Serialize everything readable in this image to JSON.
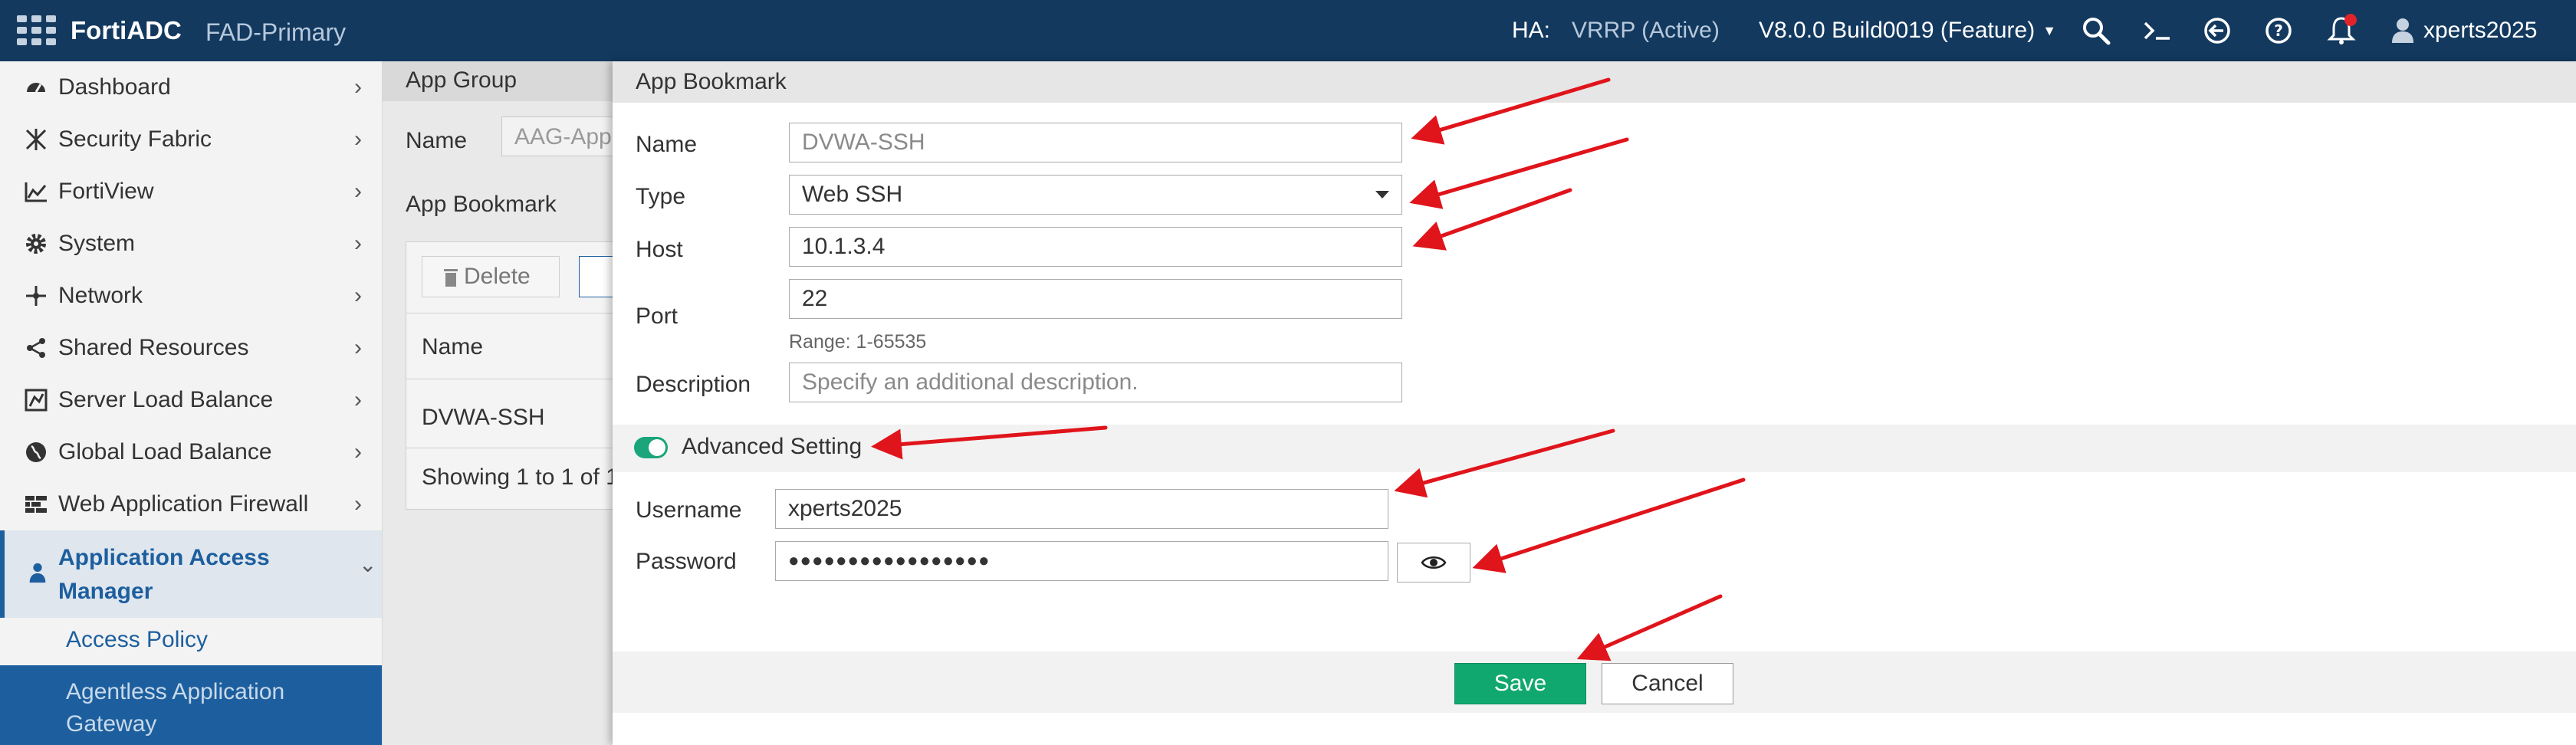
{
  "topbar": {
    "brand": "FortiADC",
    "device": "FAD-Primary",
    "ha_label": "HA:",
    "ha_value": "VRRP (Active)",
    "version": "V8.0.0 Build0019 (Feature)",
    "user": "xperts2025",
    "icons": [
      "search-icon",
      "cli-icon",
      "logout-icon",
      "help-icon",
      "bell-icon",
      "user-icon"
    ]
  },
  "sidebar": {
    "items": [
      {
        "label": "Dashboard",
        "icon": "dashboard-icon"
      },
      {
        "label": "Security Fabric",
        "icon": "fabric-icon"
      },
      {
        "label": "FortiView",
        "icon": "chart-icon"
      },
      {
        "label": "System",
        "icon": "gear-icon"
      },
      {
        "label": "Network",
        "icon": "network-icon"
      },
      {
        "label": "Shared Resources",
        "icon": "share-icon"
      },
      {
        "label": "Server Load Balance",
        "icon": "slb-icon"
      },
      {
        "label": "Global Load Balance",
        "icon": "globe-icon"
      },
      {
        "label": "Web Application Firewall",
        "icon": "firewall-icon"
      }
    ],
    "active_group": {
      "label_line1": "Application Access",
      "label_line2": "Manager",
      "icon": "user-icon"
    },
    "sub_items": [
      {
        "label": "Access Policy"
      },
      {
        "label_line1": "Agentless Application",
        "label_line2": "Gateway"
      }
    ]
  },
  "background_page": {
    "header": "App Group",
    "name_label": "Name",
    "name_value": "AAG-App",
    "section": "App Bookmark",
    "delete_label": "Delete",
    "column_name": "Name",
    "row_value": "DVWA-SSH",
    "showing": "Showing 1 to 1 of 1"
  },
  "modal": {
    "title": "App Bookmark",
    "name_label": "Name",
    "name_value": "DVWA-SSH",
    "type_label": "Type",
    "type_value": "Web SSH",
    "host_label": "Host",
    "host_value": "10.1.3.4",
    "port_label": "Port",
    "port_value": "22",
    "port_hint": "Range: 1-65535",
    "description_label": "Description",
    "description_placeholder": "Specify an additional description.",
    "advanced_label": "Advanced Setting",
    "advanced_enabled": true,
    "username_label": "Username",
    "username_value": "xperts2025",
    "password_label": "Password",
    "password_value": "●●●●●●●●●●●●●●●●●",
    "save_label": "Save",
    "cancel_label": "Cancel"
  },
  "colors": {
    "topbar": "#13395f",
    "accent": "#1d5f9e",
    "save": "#10a86f",
    "arrow": "#e0141b"
  }
}
